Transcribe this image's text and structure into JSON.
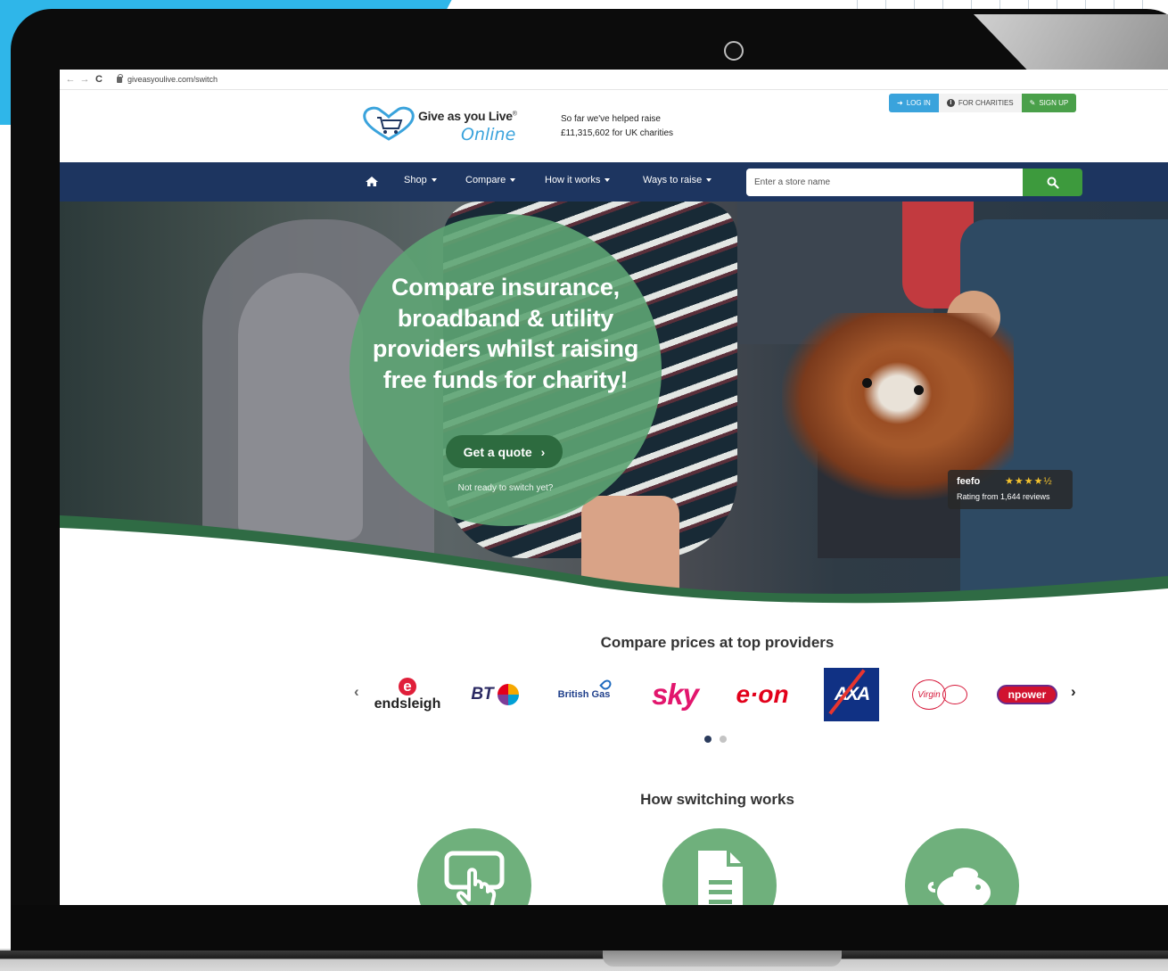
{
  "browser": {
    "url": "giveasyoulive.com/switch"
  },
  "header": {
    "logo_main": "Give as you Live",
    "logo_reg": "®",
    "logo_sub": "Online",
    "raised_line1": "So far we've helped raise",
    "raised_line2": "£11,315,602 for UK charities",
    "login_label": "LOG IN",
    "charities_label": "FOR CHARITIES",
    "signup_label": "SIGN UP"
  },
  "nav": {
    "items": [
      {
        "label": "Shop"
      },
      {
        "label": "Compare"
      },
      {
        "label": "How it works"
      },
      {
        "label": "Ways to raise"
      }
    ],
    "search_placeholder": "Enter a store name"
  },
  "hero": {
    "heading": "Compare insurance, broadband & utility providers whilst raising free funds for charity!",
    "cta_label": "Get a quote",
    "secondary_link": "Not ready to switch yet?",
    "feefo": {
      "brand": "feefo",
      "stars": "★★★★½",
      "rating": 4.5,
      "review_text": "Rating from 1,644 reviews"
    }
  },
  "providers": {
    "title": "Compare prices at top providers",
    "logos": [
      {
        "name": "endsleigh",
        "mark": "e"
      },
      {
        "name": "BT"
      },
      {
        "name": "British Gas"
      },
      {
        "name": "sky"
      },
      {
        "name": "e·on"
      },
      {
        "name": "AXA"
      },
      {
        "name": "Virgin"
      },
      {
        "name": "npower"
      }
    ],
    "carousel_page": 1,
    "carousel_pages": 2
  },
  "how": {
    "title": "How switching works",
    "steps": [
      {
        "icon": "hand-pointer-screen-icon"
      },
      {
        "icon": "document-icon"
      },
      {
        "icon": "piggy-bank-icon"
      }
    ]
  },
  "colors": {
    "navy": "#1d3560",
    "green": "#3d9a3d",
    "hero_circle": "#5da473",
    "login_blue": "#3aa3dc",
    "step_green": "#6fb07c"
  }
}
